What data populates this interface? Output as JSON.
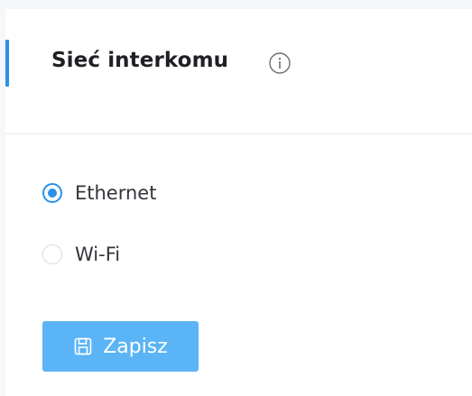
{
  "section": {
    "title": "Sieć interkomu",
    "info_icon": "info-circle-icon"
  },
  "network": {
    "options": [
      {
        "label": "Ethernet",
        "selected": true
      },
      {
        "label": "Wi-Fi",
        "selected": false
      }
    ]
  },
  "actions": {
    "save_label": "Zapisz",
    "save_icon": "save-floppy-icon"
  },
  "colors": {
    "accent": "#2a90e8",
    "button": "#5ab4f5",
    "text": "#33353b"
  }
}
